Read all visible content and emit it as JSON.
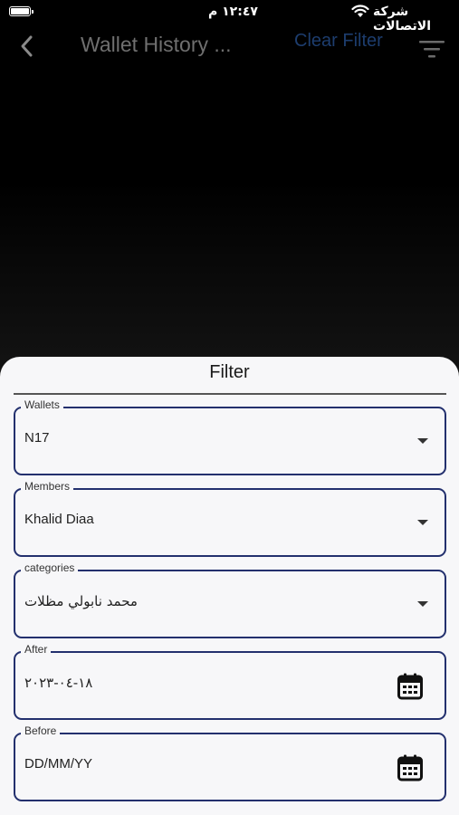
{
  "status_bar": {
    "time": "١٢:٤٧ م",
    "carrier": "شركة الاتصالات"
  },
  "nav": {
    "title": "Wallet History ...",
    "clear_filter": "Clear Filter"
  },
  "filter_sheet": {
    "title": "Filter",
    "fields": [
      {
        "label": "Wallets",
        "value": "N17"
      },
      {
        "label": "Members",
        "value": "Khalid Diaa"
      },
      {
        "label": "categories",
        "value": "محمد نابولي مظلات"
      },
      {
        "label": "After",
        "value": "١٨-٠٤-٢٠٢٣"
      },
      {
        "label": "Before",
        "value": "DD/MM/YY"
      }
    ]
  },
  "colors": {
    "field_border": "#23306e",
    "clear_filter": "#1d3d6e",
    "sheet_bg": "#f7f7f9"
  },
  "icons": [
    "back-chevron-icon",
    "filter-lines-icon",
    "dropdown-caret-icon",
    "calendar-icon",
    "wifi-icon",
    "battery-icon"
  ]
}
